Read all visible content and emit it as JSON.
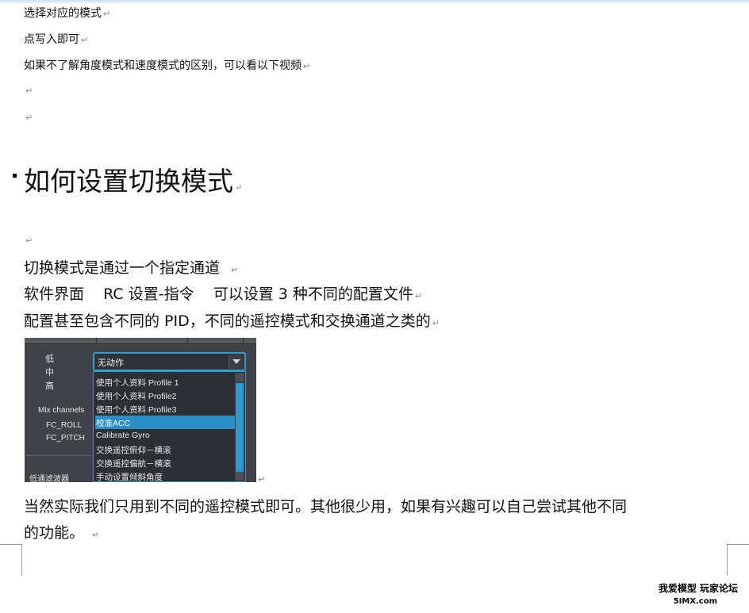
{
  "intro_lines": [
    "选择对应的模式",
    "点写入即可",
    "如果不了解角度模式和速度模式的区别，可以看以下视频"
  ],
  "paragraph_mark": "↵",
  "heading": "如何设置切换模式",
  "body_lines": [
    "切换模式是通过一个指定通道",
    "软件界面    RC 设置-指令    可以设置 3 种不同的配置文件",
    "配置甚至包含不同的 PID，不同的遥控模式和交换通道之类的"
  ],
  "screenshot": {
    "levels": [
      "低",
      "中",
      "高"
    ],
    "mix_label": "Mix channels",
    "channels": [
      "FC_ROLL",
      "FC_PITCH"
    ],
    "filter_label": "低通滤波器",
    "selected": "无动作",
    "options": [
      "使用个人资料 Profile 1",
      "使用个人资料 Profile2",
      "使用个人资料 Profile3",
      "校准ACC",
      "Calibrate Gyro",
      "交换遥控俯仰－横滚",
      "交换遥控偏航－横滚",
      "手动设置倾斜角度"
    ],
    "highlighted_index": 3
  },
  "closing": [
    "当然实际我们只用到不同的遥控模式即可。其他很少用，如果有兴趣可以自己尝试其他不同",
    "的功能。"
  ],
  "watermark": {
    "line1": "我爱模型 玩家论坛",
    "line2": "5IMX.com"
  }
}
